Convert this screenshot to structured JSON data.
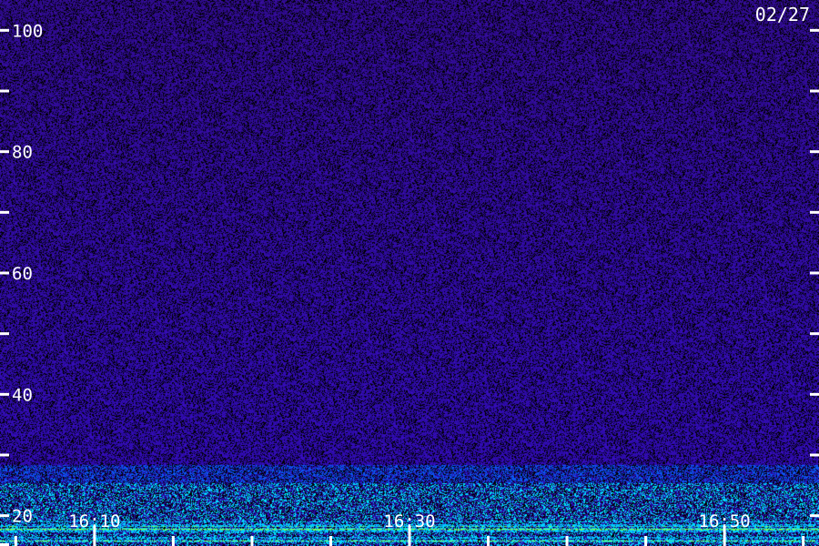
{
  "chart_data": {
    "type": "heatmap",
    "date_label": "02/27",
    "y_axis": {
      "range": [
        15,
        105
      ],
      "major_ticks": [
        20,
        40,
        60,
        80,
        100
      ],
      "tick_labels": [
        "20",
        "40",
        "60",
        "80",
        "100"
      ],
      "minor_ticks": [
        30,
        50,
        70,
        90
      ]
    },
    "x_axis": {
      "range": [
        "16:04",
        "16:56"
      ],
      "labeled_ticks": [
        "16:10",
        "16:30",
        "16:50"
      ],
      "minor_ticks": [
        "16:05",
        "16:15",
        "16:20",
        "16:25",
        "16:35",
        "16:40",
        "16:45",
        "16:55"
      ]
    },
    "colors": {
      "background_noise": "#1a0a6e",
      "low_band": "#00c8ff",
      "strong_band": "#7dff5a",
      "axis": "#ffffff"
    }
  }
}
